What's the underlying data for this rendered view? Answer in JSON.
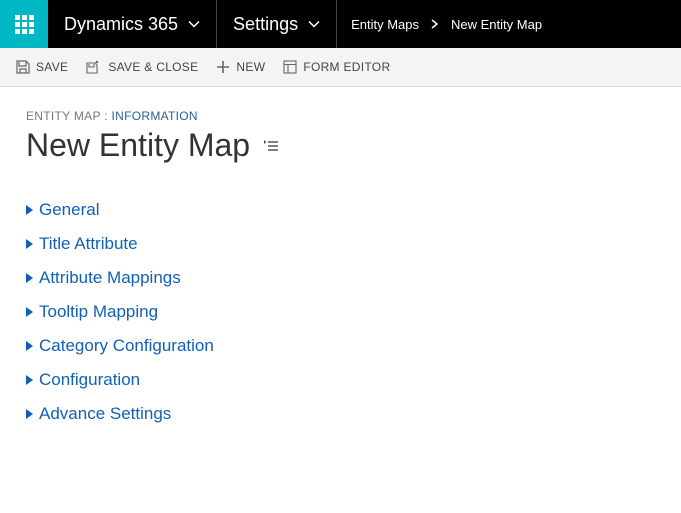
{
  "topnav": {
    "brand": "Dynamics 365",
    "area": "Settings",
    "breadcrumb_parent": "Entity Maps",
    "breadcrumb_current": "New Entity Map"
  },
  "toolbar": {
    "save": "SAVE",
    "save_close": "SAVE & CLOSE",
    "new": "NEW",
    "form_editor": "FORM EDITOR"
  },
  "record": {
    "type": "ENTITY MAP",
    "suffix": "INFORMATION",
    "title": "New Entity Map"
  },
  "sections": [
    "General",
    "Title Attribute",
    "Attribute Mappings",
    "Tooltip Mapping",
    "Category Configuration",
    "Configuration",
    "Advance Settings"
  ]
}
